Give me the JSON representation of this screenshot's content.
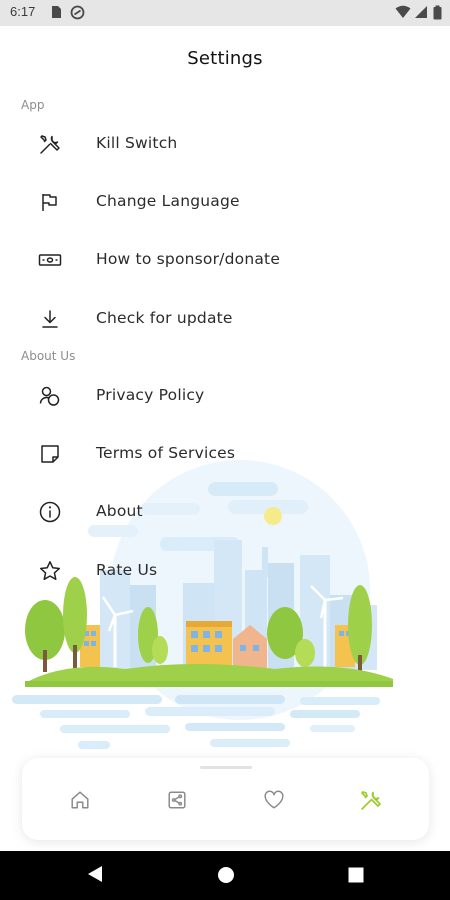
{
  "status_bar": {
    "time": "6:17"
  },
  "header": {
    "title": "Settings"
  },
  "sections": {
    "app": {
      "label": "App",
      "items": [
        {
          "label": "Kill Switch",
          "icon": "tools-icon"
        },
        {
          "label": "Change Language",
          "icon": "flag-icon"
        },
        {
          "label": "How to sponsor/donate",
          "icon": "banknote-icon"
        },
        {
          "label": "Check for update",
          "icon": "download-icon"
        }
      ]
    },
    "about": {
      "label": "About Us",
      "items": [
        {
          "label": "Privacy Policy",
          "icon": "users-icon"
        },
        {
          "label": "Terms of Services",
          "icon": "note-icon"
        },
        {
          "label": "About",
          "icon": "info-icon"
        },
        {
          "label": "Rate Us",
          "icon": "star-icon"
        }
      ]
    }
  },
  "bottom_nav": {
    "items": [
      "home-icon",
      "share-icon",
      "heart-icon",
      "tools-icon"
    ],
    "active_index": 3
  },
  "colors": {
    "accent": "#9ccc2a",
    "icon": "#222222",
    "nav_icon": "#8a8a8a"
  }
}
